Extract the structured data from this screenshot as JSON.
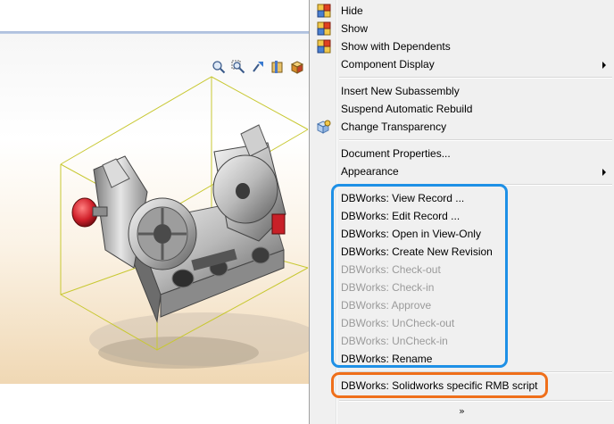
{
  "context_menu": {
    "items": [
      {
        "label": "Hide",
        "icon": "component-icon",
        "enabled": true,
        "submenu": false
      },
      {
        "label": "Show",
        "icon": "component-icon",
        "enabled": true,
        "submenu": false
      },
      {
        "label": "Show with Dependents",
        "icon": "component-icon",
        "enabled": true,
        "submenu": false
      },
      {
        "label": "Component Display",
        "icon": "",
        "enabled": true,
        "submenu": true
      },
      {
        "label": "Insert New Subassembly",
        "icon": "",
        "enabled": true,
        "submenu": false
      },
      {
        "label": "Suspend Automatic Rebuild",
        "icon": "",
        "enabled": true,
        "submenu": false
      },
      {
        "label": "Change Transparency",
        "icon": "transparency-icon",
        "enabled": true,
        "submenu": false
      },
      {
        "label": "Document Properties...",
        "icon": "",
        "enabled": true,
        "submenu": false
      },
      {
        "label": "Appearance",
        "icon": "",
        "enabled": true,
        "submenu": true
      },
      {
        "label": "DBWorks: View Record ...",
        "icon": "",
        "enabled": true,
        "submenu": false
      },
      {
        "label": "DBWorks: Edit Record ...",
        "icon": "",
        "enabled": true,
        "submenu": false
      },
      {
        "label": "DBWorks: Open in View-Only",
        "icon": "",
        "enabled": true,
        "submenu": false
      },
      {
        "label": "DBWorks: Create New Revision",
        "icon": "",
        "enabled": true,
        "submenu": false
      },
      {
        "label": "DBWorks: Check-out",
        "icon": "",
        "enabled": false,
        "submenu": false
      },
      {
        "label": "DBWorks: Check-in",
        "icon": "",
        "enabled": false,
        "submenu": false
      },
      {
        "label": "DBWorks: Approve",
        "icon": "",
        "enabled": false,
        "submenu": false
      },
      {
        "label": "DBWorks: UnCheck-out",
        "icon": "",
        "enabled": false,
        "submenu": false
      },
      {
        "label": "DBWorks: UnCheck-in",
        "icon": "",
        "enabled": false,
        "submenu": false
      },
      {
        "label": "DBWorks: Rename",
        "icon": "",
        "enabled": true,
        "submenu": false
      },
      {
        "label": "DBWorks: Solidworks specific RMB script",
        "icon": "",
        "enabled": true,
        "submenu": false
      }
    ],
    "expand_glyph": "»"
  },
  "view_toolbar": {
    "buttons": [
      "zoom-to-fit-icon",
      "zoom-to-area-icon",
      "previous-view-icon",
      "section-view-icon",
      "view-orientation-icon"
    ]
  },
  "colors": {
    "highlight_primary": "#1e90e6",
    "highlight_secondary": "#ef6f1a",
    "bounding_box": "#c8c832",
    "knob": "#d0202a"
  }
}
